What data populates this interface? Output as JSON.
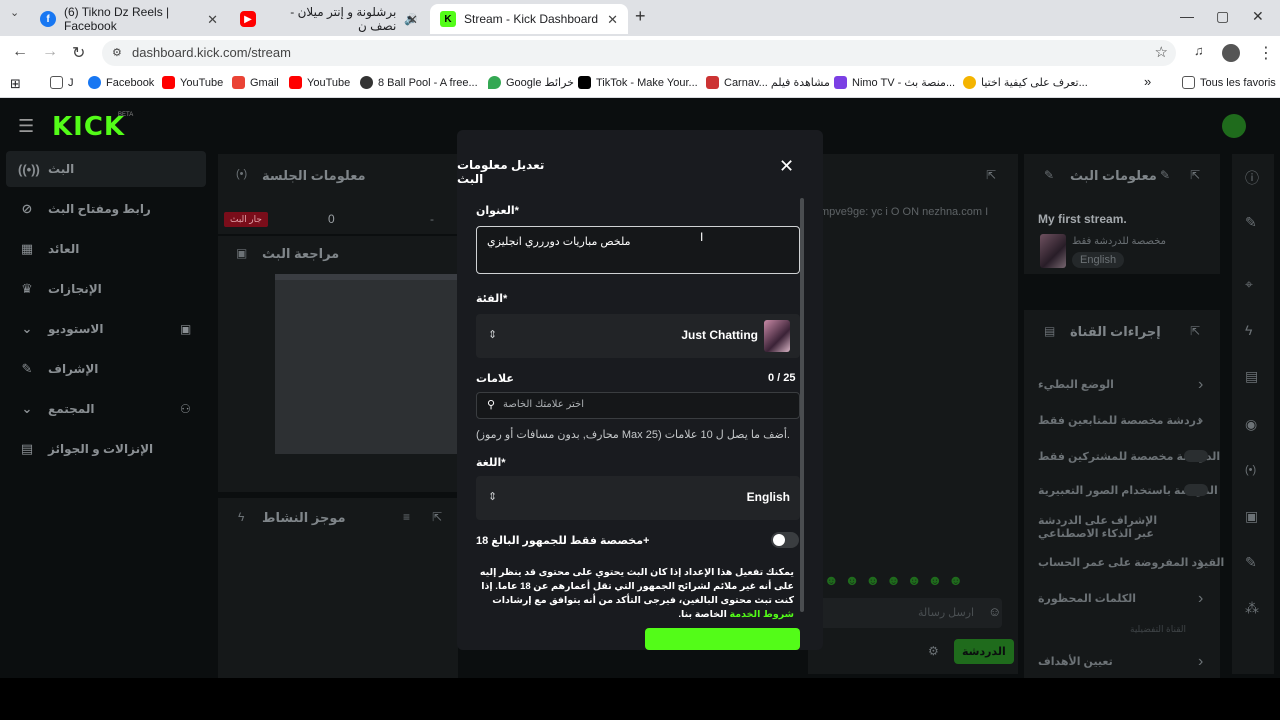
{
  "browser": {
    "tabs": [
      {
        "title": "(6) Tikno Dz Reels | Facebook",
        "favicon": "facebook-icon",
        "color": "#1877f2"
      },
      {
        "title": "برشلونة و إنتر ميلان - نصف ن",
        "favicon": "youtube-icon",
        "color": "#ff0000"
      },
      {
        "title": "Stream - Kick Dashboard",
        "favicon": "kick-icon",
        "color": "#53fc18"
      }
    ],
    "url": "dashboard.kick.com/stream",
    "bookmarks": [
      {
        "label": "J"
      },
      {
        "label": "Facebook"
      },
      {
        "label": "YouTube"
      },
      {
        "label": "Gmail"
      },
      {
        "label": "YouTube"
      },
      {
        "label": "8 Ball Pool - A free..."
      },
      {
        "label": "Google خرائط"
      },
      {
        "label": "TikTok - Make Your..."
      },
      {
        "label": "Carnav... مشاهدة فيلم"
      },
      {
        "label": "Nimo TV - منصة بث..."
      },
      {
        "label": "تعرف على كيفية اختيا..."
      },
      {
        "label": "Tous les favoris"
      }
    ]
  },
  "app": {
    "logo": "KICK",
    "logo_badge": "BETA",
    "left_nav": [
      {
        "label": "البث",
        "icon": "broadcast-icon"
      },
      {
        "label": "رابط ومفتاح البث",
        "icon": "link-icon"
      },
      {
        "label": "العائد",
        "icon": "revenue-icon"
      },
      {
        "label": "الإنجازات",
        "icon": "trophy-icon"
      },
      {
        "label": "الاستوديو",
        "icon": "studio-icon"
      },
      {
        "label": "الإشراف",
        "icon": "wrench-icon"
      },
      {
        "label": "المجتمع",
        "icon": "community-icon"
      },
      {
        "label": "الإنزالات و الجوائز",
        "icon": "drops-icon"
      }
    ],
    "session_panel": {
      "title": "معلومات الجلسة",
      "value_left": "0",
      "value_mid": "-",
      "live_badge": "جار البث"
    },
    "review_panel": {
      "title": "مراجعة البث"
    },
    "activity_panel": {
      "title": "موجز النشاط"
    },
    "chat": {
      "message": "mpve9ge: yc i O ON nezhna.com I",
      "placeholder": "ارسل رسالة",
      "send_label": "الدردشة"
    },
    "stream_info_panel": {
      "title": "معلومات البث",
      "stream_title": "My first stream.",
      "restriction": "مخصصة للدردشة فقط",
      "language": "English"
    },
    "channel_actions": {
      "title": "إجراءات القناة",
      "items": [
        "الوضع البطيء",
        "دردشة مخصصة للمتابعين فقط",
        "الدردشة مخصصة للمشتركين فقط",
        "الدردشة باستخدام الصور التعبيرية",
        "الإشراف على الدردشة عبر الذكاء الاصطناعي",
        "القيود المفروضة على عمر الحساب",
        "الكلمات المحظورة"
      ],
      "section_label": "القناة التفضيلية",
      "goals": "تعيين الأهداف"
    }
  },
  "modal": {
    "title": "تعديل معلومات البث",
    "title_label": "العنوان*",
    "title_value": "ملخص مباريات دوررري انجليزي",
    "category_label": "الفئة*",
    "category_value": "Just Chatting",
    "tags_label": "علامات",
    "tags_count": "0 / 25",
    "tags_placeholder": "اختر علامتك الخاصة",
    "tags_hint": "(محارف, بدون مسافات أو رموز Max 25) أضف ما يصل ل 10 علامات.",
    "language_label": "اللغة*",
    "language_value": "English",
    "adult_label": "مخصصة فقط للجمهور البالغ 18+",
    "adult_enabled": false,
    "adult_desc": "يمكنك تفعيل هذا الإعداد إذا كان البث يحتوي على محتوى قد ينظر إليه على أنه غير ملائم لشرائح الجمهور التي تقل أعمارهم عن 18 عاما. إذا كنت تبث محتوى البالغين، فيرجى التأكد من أنه يتوافق مع إرشادات",
    "adult_link": "شروط الخدمة",
    "adult_desc_end": "الخاصة بنا."
  },
  "colors": {
    "accent": "#53fc18",
    "live": "#e4002b"
  }
}
